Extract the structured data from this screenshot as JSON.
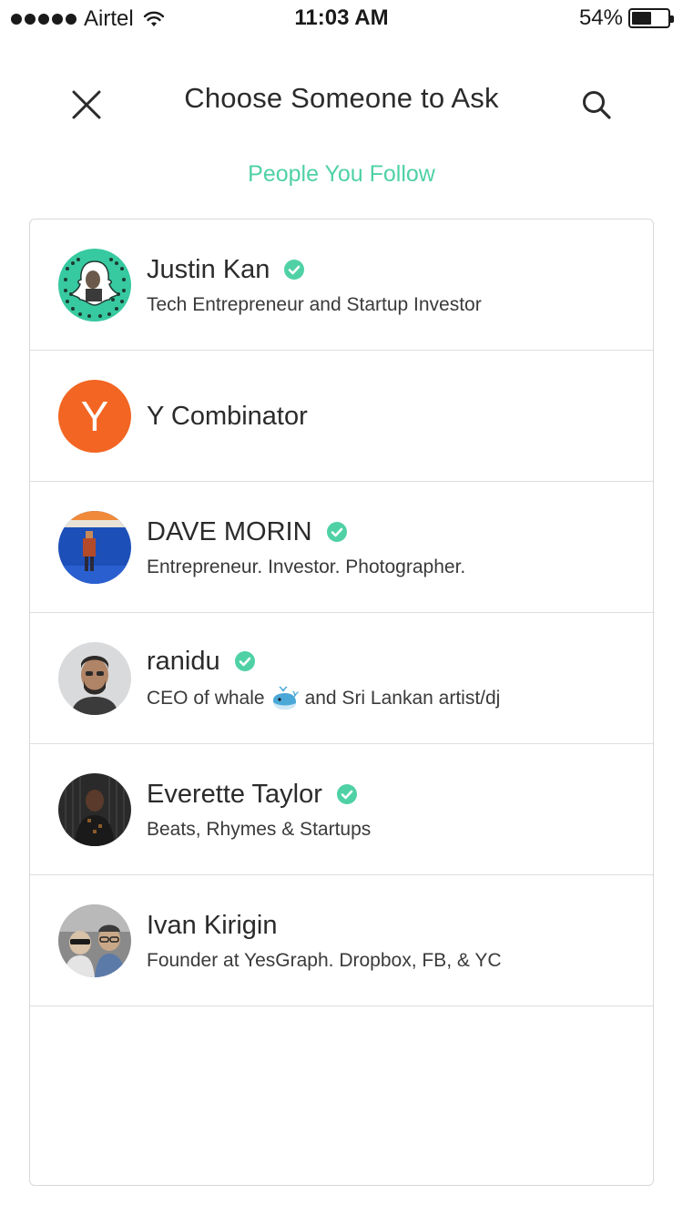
{
  "status_bar": {
    "carrier": "Airtel",
    "time": "11:03 AM",
    "battery_percent": "54%",
    "battery_level": 0.54
  },
  "header": {
    "title": "Choose Someone to Ask"
  },
  "section": {
    "label": "People You Follow"
  },
  "colors": {
    "accent": "#4fd1a5",
    "text": "#2b2b2b",
    "divider": "#dedede"
  },
  "people": [
    {
      "name": "Justin Kan",
      "verified": true,
      "bio": "Tech Entrepreneur and Startup Investor"
    },
    {
      "name": "Y Combinator",
      "verified": false,
      "bio": "",
      "avatar_letter": "Y"
    },
    {
      "name": "DAVE MORIN",
      "verified": true,
      "bio": "Entrepreneur. Investor. Photographer."
    },
    {
      "name": "ranidu",
      "verified": true,
      "bio_before": "CEO of whale",
      "bio_after": "and Sri Lankan artist/dj"
    },
    {
      "name": "Everette Taylor",
      "verified": true,
      "bio": "Beats, Rhymes & Startups"
    },
    {
      "name": "Ivan Kirigin",
      "verified": false,
      "bio": "Founder at YesGraph. Dropbox, FB, & YC"
    }
  ]
}
